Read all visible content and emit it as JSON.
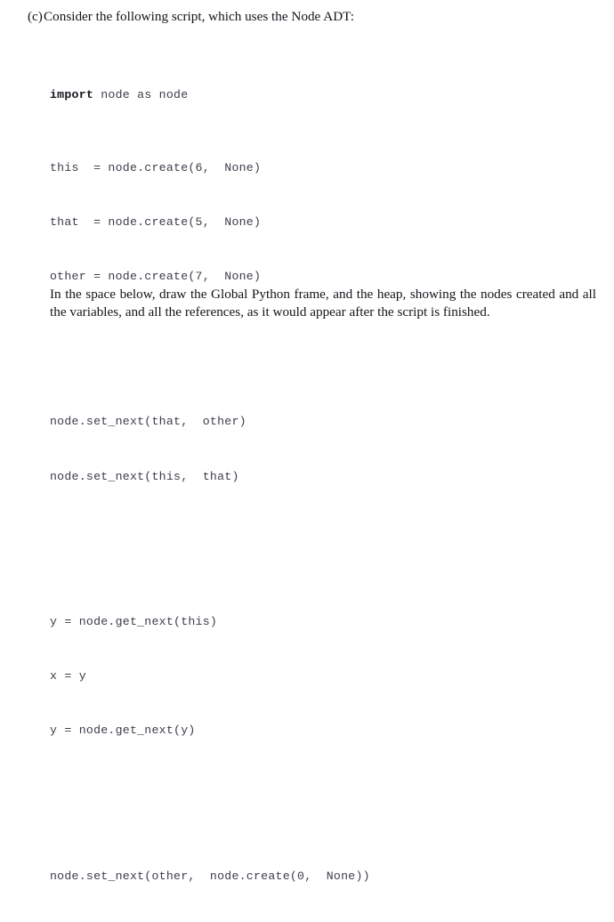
{
  "question": {
    "label": "(c)",
    "prompt": "Consider the following script, which uses the Node ADT:"
  },
  "code": {
    "language": "python",
    "keyword": "import",
    "lines": [
      {
        "type": "code",
        "keyword": "import",
        "rest": " node as node"
      },
      {
        "type": "code",
        "text": "this  = node.create(6,  None)"
      },
      {
        "type": "code",
        "text": "that  = node.create(5,  None)"
      },
      {
        "type": "code",
        "text": "other = node.create(7,  None)"
      },
      {
        "type": "blank",
        "text": ""
      },
      {
        "type": "code",
        "text": "node.set_next(that,  other)"
      },
      {
        "type": "code",
        "text": "node.set_next(this,  that)"
      },
      {
        "type": "blank",
        "text": ""
      },
      {
        "type": "code",
        "text": "y = node.get_next(this)"
      },
      {
        "type": "code",
        "text": "x = y"
      },
      {
        "type": "code",
        "text": "y = node.get_next(y)"
      },
      {
        "type": "blank",
        "text": ""
      },
      {
        "type": "code",
        "text": "node.set_next(other,  node.create(0,  None))"
      }
    ]
  },
  "instruction": {
    "text": "In the space below, draw the Global Python frame, and the heap, showing the nodes created and all the variables, and all the references, as it would appear after the script is finished."
  },
  "colors": {
    "page_background": "#ffffff",
    "body_text": "#14131b",
    "code_text": "#3d3c4a",
    "code_keyword": "#16151d"
  }
}
